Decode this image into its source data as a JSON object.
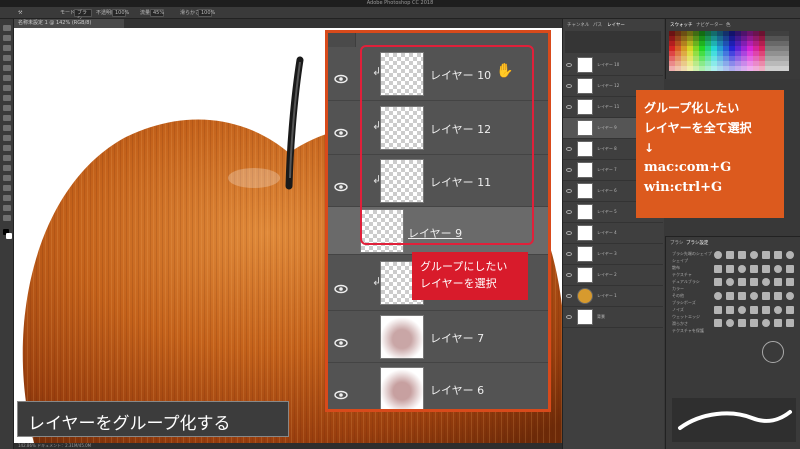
{
  "window": {
    "title": "Adobe Photoshop CC 2018"
  },
  "options_bar": {
    "items": [
      "モード：",
      "ブラシ",
      "不透明度：",
      "100%",
      "流量：",
      "45%",
      "滑らかさ：",
      "100%"
    ]
  },
  "document_tab": {
    "label": "名称未設定 1 @ 142% (RGB/8)"
  },
  "status_bar": {
    "text": "142.86%   ドキュメント：2.31M/45.0M"
  },
  "zoom_layers": [
    {
      "name": "レイヤー 10",
      "clipped": true,
      "underlined": false
    },
    {
      "name": "レイヤー 12",
      "clipped": true,
      "underlined": false
    },
    {
      "name": "レイヤー 11",
      "clipped": true,
      "underlined": false
    },
    {
      "name": "レイヤー 9",
      "clipped": false,
      "underlined": true
    },
    {
      "name": "",
      "clipped": true,
      "underlined": false
    },
    {
      "name": "レイヤー 7",
      "clipped": false,
      "underlined": false
    },
    {
      "name": "レイヤー 6",
      "clipped": false,
      "underlined": false
    }
  ],
  "callout_red": {
    "line1": "グループにしたい",
    "line2": "レイヤーを選択"
  },
  "callout_orange": {
    "line1": "グループ化したい",
    "line2": "レイヤーを全て選択",
    "line3": "↓",
    "line4": "mac:com+G",
    "line5": "win:ctrl+G"
  },
  "caption": {
    "text": "レイヤーをグループ化する"
  },
  "right_panel": {
    "tabs": [
      "チャンネル",
      "パス",
      "レイヤー"
    ],
    "swatch_tabs": [
      "スウォッチ",
      "ナビゲーター",
      "色"
    ],
    "brush_tabs": [
      "ブラシ",
      "ブラシ設定"
    ],
    "layers": [
      "レイヤー 10",
      "レイヤー 12",
      "レイヤー 11",
      "レイヤー 9",
      "レイヤー 8",
      "レイヤー 7",
      "レイヤー 6",
      "レイヤー 5",
      "レイヤー 4",
      "レイヤー 3",
      "レイヤー 2",
      "レイヤー 1",
      "背景"
    ],
    "brush_options": [
      "ブラシ先端のシェイプ",
      "シェイプ",
      "散布",
      "テクスチャ",
      "デュアルブラシ",
      "カラー",
      "その他",
      "ブラシポーズ",
      "ノイズ",
      "ウェットエッジ",
      "滑らかさ",
      "テクスチャを保護"
    ]
  },
  "colors": {
    "accent_orange": "#dc5a1e",
    "accent_red": "#e0203a",
    "callout_red_bg": "#d81b2b",
    "apple_base": "#c4621b"
  }
}
